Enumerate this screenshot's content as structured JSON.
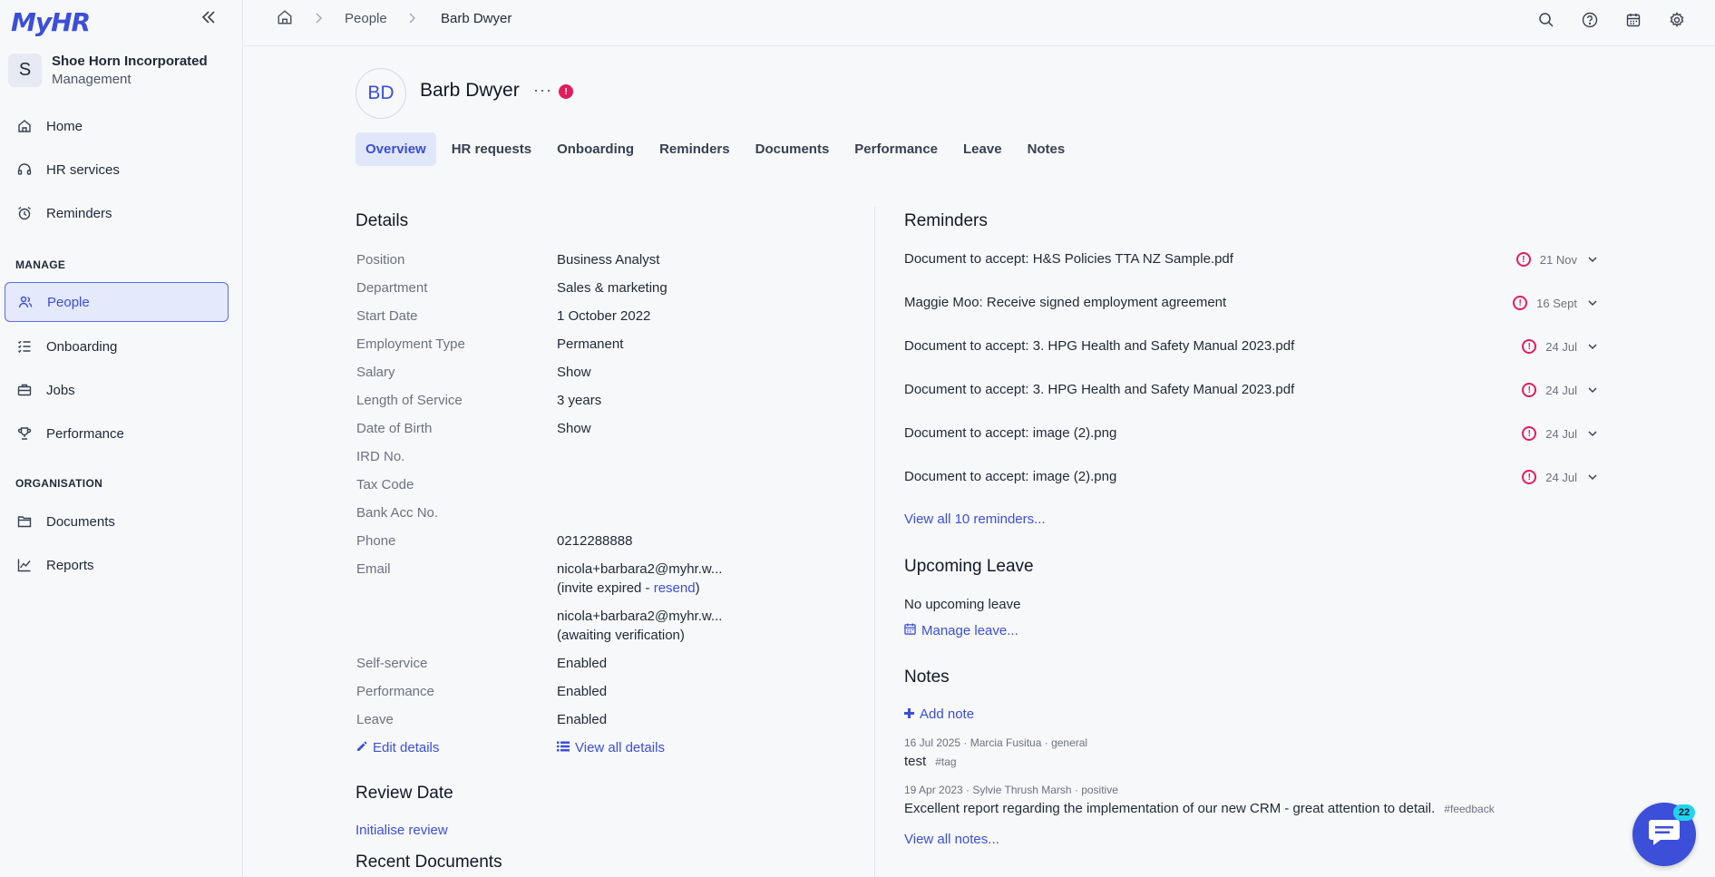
{
  "app": {
    "logo": "MyHR"
  },
  "org": {
    "initial": "S",
    "name": "Shoe Horn Incorporated",
    "role": "Management"
  },
  "nav": {
    "top": [
      {
        "label": "Home",
        "icon": "home-icon"
      },
      {
        "label": "HR services",
        "icon": "headset-icon"
      },
      {
        "label": "Reminders",
        "icon": "alarm-icon"
      }
    ],
    "manage_label": "MANAGE",
    "manage": [
      {
        "label": "People",
        "icon": "people-icon"
      },
      {
        "label": "Onboarding",
        "icon": "checklist-icon"
      },
      {
        "label": "Jobs",
        "icon": "briefcase-icon"
      },
      {
        "label": "Performance",
        "icon": "trophy-icon"
      }
    ],
    "org_label": "ORGANISATION",
    "organisation": [
      {
        "label": "Documents",
        "icon": "folder-icon"
      },
      {
        "label": "Reports",
        "icon": "chart-line-icon"
      }
    ]
  },
  "breadcrumb": {
    "people": "People",
    "current": "Barb Dwyer"
  },
  "person": {
    "initials": "BD",
    "name": "Barb Dwyer",
    "more": "···",
    "alert": "!"
  },
  "tabs": [
    "Overview",
    "HR requests",
    "Onboarding",
    "Reminders",
    "Documents",
    "Performance",
    "Leave",
    "Notes"
  ],
  "details": {
    "title": "Details",
    "rows": [
      {
        "k": "Position",
        "v": "Business Analyst"
      },
      {
        "k": "Department",
        "v": "Sales & marketing"
      },
      {
        "k": "Start Date",
        "v": "1 October 2022"
      },
      {
        "k": "Employment Type",
        "v": "Permanent"
      },
      {
        "k": "Salary",
        "v": "Show"
      },
      {
        "k": "Length of Service",
        "v": "3 years"
      },
      {
        "k": "Date of Birth",
        "v": "Show"
      },
      {
        "k": "IRD No.",
        "v": ""
      },
      {
        "k": "Tax Code",
        "v": ""
      },
      {
        "k": "Bank Acc No.",
        "v": ""
      },
      {
        "k": "Phone",
        "v": "0212288888"
      }
    ],
    "email_label": "Email",
    "email1": "nicola+barbara2@myhr.w...",
    "email1_status_pre": "(invite expired - ",
    "email1_resend": "resend",
    "email1_status_post": ")",
    "email2": "nicola+barbara2@myhr.w...",
    "email2_status": "(awaiting verification)",
    "rows2": [
      {
        "k": "Self-service",
        "v": "Enabled"
      },
      {
        "k": "Performance",
        "v": "Enabled"
      },
      {
        "k": "Leave",
        "v": "Enabled"
      }
    ],
    "edit": "Edit details",
    "view_all": "View all details"
  },
  "review": {
    "title": "Review Date",
    "action": "Initialise review"
  },
  "recent_docs": {
    "title": "Recent Documents"
  },
  "reminders": {
    "title": "Reminders",
    "items": [
      {
        "text": "Document to accept: H&S Policies TTA NZ Sample.pdf",
        "date": "21 Nov"
      },
      {
        "text": "Maggie Moo: Receive signed employment agreement",
        "date": "16 Sept"
      },
      {
        "text": "Document to accept: 3. HPG Health and Safety Manual 2023.pdf",
        "date": "24 Jul"
      },
      {
        "text": "Document to accept: 3. HPG Health and Safety Manual 2023.pdf",
        "date": "24 Jul"
      },
      {
        "text": "Document to accept: image (2).png",
        "date": "24 Jul"
      },
      {
        "text": "Document to accept: image (2).png",
        "date": "24 Jul"
      }
    ],
    "view_all": "View all 10 reminders..."
  },
  "leave": {
    "title": "Upcoming Leave",
    "empty": "No upcoming leave",
    "manage": "Manage leave..."
  },
  "notes": {
    "title": "Notes",
    "add": "Add note",
    "items": [
      {
        "meta": "16 Jul 2025 · Marcia Fusitua · general",
        "text": "test",
        "tag": "#tag"
      },
      {
        "meta": "19 Apr 2023 · Sylvie Thrush Marsh · positive",
        "text": "Excellent report regarding the implementation of our new CRM - great attention to detail.",
        "tag": "#feedback"
      }
    ],
    "view_all": "View all notes..."
  },
  "chat": {
    "badge": "22"
  },
  "colors": {
    "accent": "#3b4fd8",
    "alert": "#e11d5c",
    "active_bg": "#e4e9fb"
  }
}
